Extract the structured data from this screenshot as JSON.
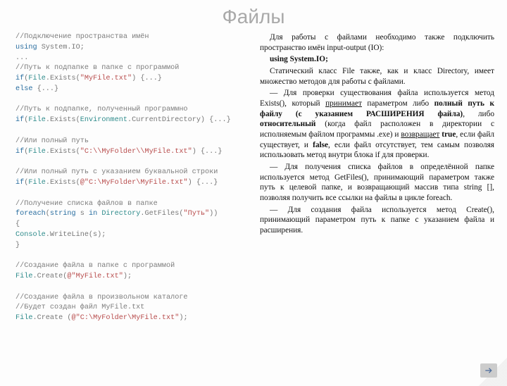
{
  "title": "Файлы",
  "code": {
    "l1": "//Подключение пространства имён",
    "l2a": "using",
    "l2b": " System.IO;",
    "l3": "...",
    "l4": "//Путь к подпапке в папке с программой",
    "l5a": "if",
    "l5b": "(",
    "l5c": "File",
    "l5d": ".Exists(",
    "l5e": "\"MyFile.txt\"",
    "l5f": ") {...}",
    "l6a": "else",
    "l6b": " {...}",
    "l7": "",
    "l8": "//Путь к подпапке, полученный программно",
    "l9a": "if",
    "l9b": "(",
    "l9c": "File",
    "l9d": ".Exists(",
    "l9e": "Environment",
    "l9f": ".CurrentDirectory) {...}",
    "l10": "",
    "l11": "//Или полный путь",
    "l12a": "if",
    "l12b": "(",
    "l12c": "File",
    "l12d": ".Exists(",
    "l12e": "\"C:\\\\MyFolder\\\\MyFile.txt\"",
    "l12f": ") {...}",
    "l13": "",
    "l14": "//Или полный путь с указанием буквальной строки",
    "l15a": "if",
    "l15b": "(",
    "l15c": "File",
    "l15d": ".Exists(",
    "l15e": "@\"C:\\MyFolder\\MyFile.txt\"",
    "l15f": ") {...}",
    "l16": "",
    "l17": "//Получение списка файлов в папке",
    "l18a": "foreach",
    "l18b": "(",
    "l18c": "string",
    "l18d": " s ",
    "l18e": "in",
    "l18f": " ",
    "l18g": "Directory",
    "l18h": ".GetFiles(",
    "l18i": "\"Путь\"",
    "l18j": "))",
    "l19": "{",
    "l20a": "      ",
    "l20b": "Console",
    "l20c": ".WriteLine(s);",
    "l21": "}",
    "l22": "",
    "l23": "//Создание файла в папке с программой",
    "l24a": "File",
    "l24b": ".Create(",
    "l24c": "@\"MyFile.txt\"",
    "l24d": ");",
    "l25": "",
    "l26": "//Создание файла в произвольном каталоге",
    "l27": "//Будет создан файл MyFile.txt",
    "l28a": "File",
    "l28b": ".Create (",
    "l28c": "@\"C:\\MyFolder\\MyFile.txt\"",
    "l28d": ");"
  },
  "text": {
    "p1": "Для работы с файлами необходимо также подключить пространство имён input-output (IO):",
    "p2": "using System.IO;",
    "p3": "Статический класс File также, как и класс Directory, имеет множество методов для работы с файлами.",
    "p4a": "— Для проверки существования файла используется метод Exists(), который ",
    "p4b": "принимает",
    "p4c": " параметром либо ",
    "p4d": "полный путь к файлу (с указанием РАСШИРЕНИЯ файла)",
    "p4e": ", либо ",
    "p4f": "относительный",
    "p4g": " (когда файл расположен в директории с исполняемым файлом программы .exe) и ",
    "p4h": "возвращает",
    "p4i": " ",
    "p4j": "true",
    "p4k": ", если файл существует, и ",
    "p4l": "false",
    "p4m": ", если файл отсутствует, тем самым позволяя использовать метод внутри блока if для проверки.",
    "p5": "— Для получения списка файлов в определённой папке используется метод GetFiles(), принимающий параметром также путь к целевой папке, и возвращающий массив типа string [], позволяя получить все ссылки на файлы в цикле foreach.",
    "p6": "— Для создания файла используется метод Create(), принимающий параметром путь к папке с указанием файла и расширения."
  }
}
